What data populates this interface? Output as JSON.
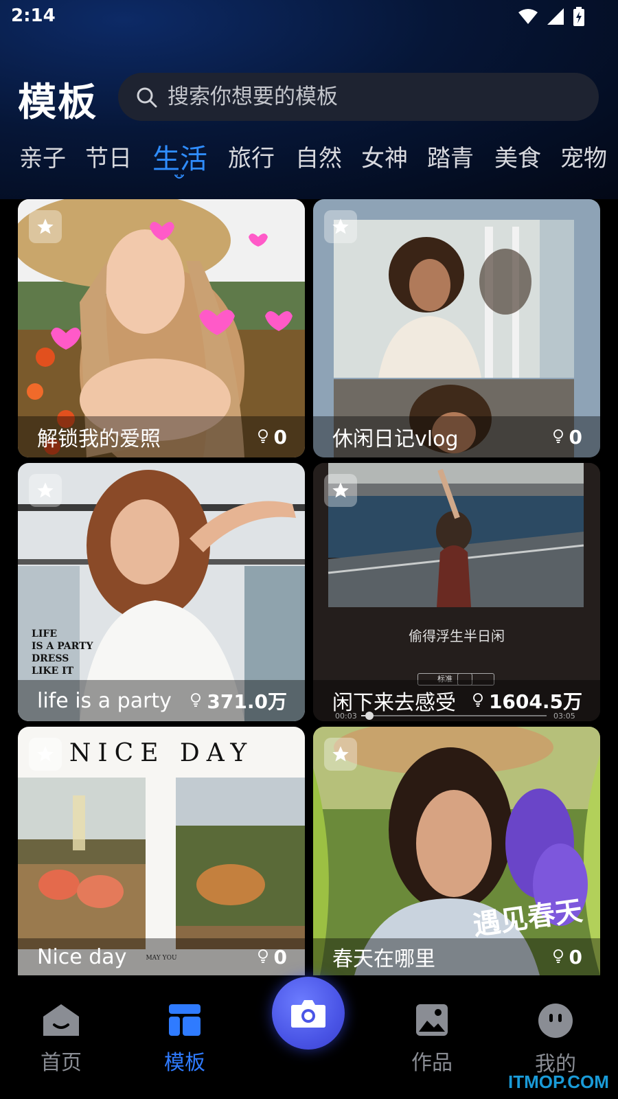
{
  "status_bar": {
    "time": "2:14"
  },
  "header": {
    "title": "模板",
    "search_placeholder": "搜索你想要的模板"
  },
  "categories": [
    {
      "label": "亲子"
    },
    {
      "label": "节日"
    },
    {
      "label": "生活",
      "active": true
    },
    {
      "label": "旅行"
    },
    {
      "label": "自然"
    },
    {
      "label": "女神"
    },
    {
      "label": "踏青"
    },
    {
      "label": "美食"
    },
    {
      "label": "宠物"
    }
  ],
  "templates": [
    {
      "title": "解锁我的爱照",
      "likes": "0"
    },
    {
      "title": "休闲日记vlog",
      "likes": "0"
    },
    {
      "title": "life is a party",
      "likes": "371.0万",
      "overlay_text": [
        "LIFE",
        "IS A PARTY",
        "DRESS",
        "LIKE IT"
      ]
    },
    {
      "title": "闲下来去感受",
      "likes": "1604.5万",
      "subtitle": "偷得浮生半日闲",
      "player": {
        "quality": "标准",
        "elapsed": "00:03",
        "total": "03:05",
        "progress": 0.03
      }
    },
    {
      "title": "Nice day",
      "likes": "0",
      "heading": "NICE DAY",
      "footer": "MAY YOU"
    },
    {
      "title": "春天在哪里",
      "likes": "0",
      "overlay_text": "遇见春天"
    }
  ],
  "bottom_nav": {
    "home": "首页",
    "templates": "模板",
    "works": "作品",
    "profile": "我的"
  },
  "watermark": "ITMOP.COM",
  "colors": {
    "accent": "#2f7bff",
    "fab": "#4a55e6"
  }
}
